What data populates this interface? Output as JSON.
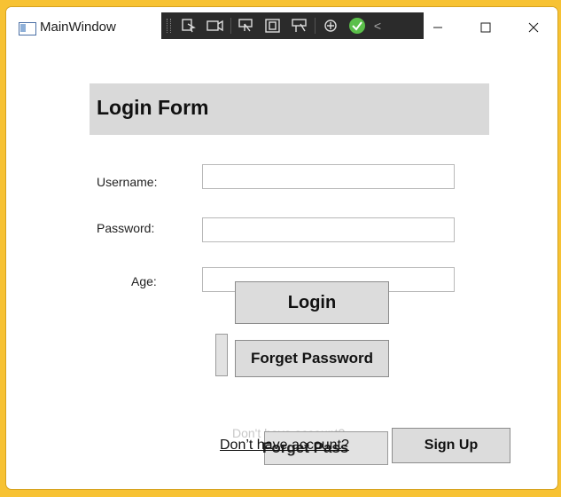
{
  "window": {
    "title": "MainWindow",
    "controls": {
      "minimize": "–",
      "maximize": "☐",
      "close": "✕"
    }
  },
  "debug_toolbar": {
    "icons": [
      "select-element-icon",
      "camera-icon",
      "display-layout-adorners-icon",
      "track-focused-element-icon",
      "preview-selection-icon",
      "hot-reload-icon",
      "binding-status-ok-icon",
      "collapse-toolbar-icon"
    ],
    "status_color": "#5bbf4a",
    "collapse_glyph": "<"
  },
  "form": {
    "title": "Login Form",
    "labels": {
      "username": "Username:",
      "password": "Password:",
      "age": "Age:"
    },
    "inputs": {
      "username": "",
      "password": "",
      "age": ""
    },
    "buttons": {
      "login": "Login",
      "forget_password": "Forget Password",
      "sign_up": "Sign Up"
    },
    "overlapped": {
      "ghost_text": "Don't have account?",
      "forget_partial": "Forget Pass"
    },
    "link": "Don’t have account?"
  }
}
